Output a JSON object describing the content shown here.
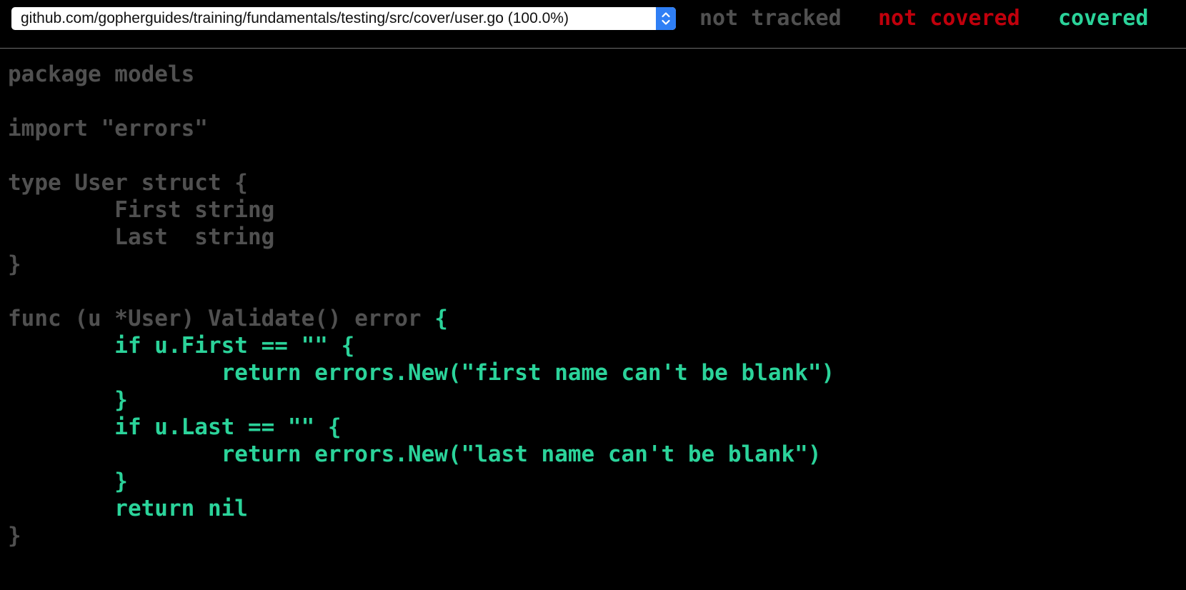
{
  "file_select": {
    "selected": "github.com/gopherguides/training/fundamentals/testing/src/cover/user.go (100.0%)"
  },
  "legend": {
    "not_tracked": "not tracked",
    "not_covered": "not covered",
    "covered": "covered"
  },
  "colors": {
    "not_tracked": "#505050",
    "not_covered": "#c0000c",
    "covered": "#2bd39a",
    "background": "#000000",
    "select_accent": "#2f7ff5"
  },
  "code": {
    "lines": [
      [
        {
          "text": "package models",
          "status": "not_tracked"
        }
      ],
      [],
      [
        {
          "text": "import \"errors\"",
          "status": "not_tracked"
        }
      ],
      [],
      [
        {
          "text": "type User struct {",
          "status": "not_tracked"
        }
      ],
      [
        {
          "text": "\tFirst string",
          "status": "not_tracked"
        }
      ],
      [
        {
          "text": "\tLast  string",
          "status": "not_tracked"
        }
      ],
      [
        {
          "text": "}",
          "status": "not_tracked"
        }
      ],
      [],
      [
        {
          "text": "func (u *User) Validate() error ",
          "status": "not_tracked"
        },
        {
          "text": "{",
          "status": "covered"
        }
      ],
      [
        {
          "text": "\tif u.First == \"\" {",
          "status": "covered"
        }
      ],
      [
        {
          "text": "\t\treturn errors.New(\"first name can't be blank\")",
          "status": "covered"
        }
      ],
      [
        {
          "text": "\t}",
          "status": "covered"
        }
      ],
      [
        {
          "text": "\tif u.Last == \"\" {",
          "status": "covered"
        }
      ],
      [
        {
          "text": "\t\treturn errors.New(\"last name can't be blank\")",
          "status": "covered"
        }
      ],
      [
        {
          "text": "\t}",
          "status": "covered"
        }
      ],
      [
        {
          "text": "\treturn nil",
          "status": "covered"
        }
      ],
      [
        {
          "text": "}",
          "status": "not_tracked"
        }
      ]
    ]
  }
}
